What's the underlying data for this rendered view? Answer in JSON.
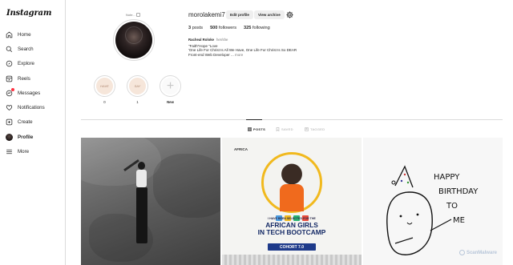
{
  "app": {
    "logo": "Instagram"
  },
  "sidebar": {
    "items": [
      {
        "label": "Home",
        "icon": "home-icon"
      },
      {
        "label": "Search",
        "icon": "search-icon"
      },
      {
        "label": "Explore",
        "icon": "explore-icon"
      },
      {
        "label": "Reels",
        "icon": "reels-icon"
      },
      {
        "label": "Messages",
        "icon": "messages-icon"
      },
      {
        "label": "Notifications",
        "icon": "heart-icon"
      },
      {
        "label": "Create",
        "icon": "create-icon"
      },
      {
        "label": "Profile",
        "icon": "profile-avatar"
      },
      {
        "label": "More",
        "icon": "menu-icon"
      }
    ]
  },
  "profile": {
    "note": "Note...",
    "username": "morolakemi7",
    "edit_profile": "Edit profile",
    "view_archive": "View archive",
    "posts_count": "3",
    "posts_label": "posts",
    "followers_count": "500",
    "followers_label": "followers",
    "following_count": "325",
    "following_label": "following",
    "full_name": "Racheal Roloke",
    "pronouns": "her/she",
    "bio_line1": "\"Faith\"Hope \"Love",
    "bio_line2": "'One Life For Christ Is All We Have, One Life For Christ Is So DEAR",
    "bio_line3": "Front-end Web Developer ...",
    "bio_more": "more"
  },
  "highlights": [
    {
      "label": "0",
      "thumb": "HAVE"
    },
    {
      "label": "1",
      "thumb": "SAY"
    },
    {
      "label": "New",
      "thumb": "+"
    }
  ],
  "tabs": [
    {
      "label": "POSTS",
      "active": true
    },
    {
      "label": "SAVED",
      "active": false
    },
    {
      "label": "TAGGED",
      "active": false
    }
  ],
  "posts": {
    "post2": {
      "logo": "AFRICA",
      "selected_text": "I HAVE BEEN SELECTED FOR THE",
      "headline1": "AFRICAN GIRLS",
      "headline2": "IN TECH BOOTCAMP",
      "cohort": "COHORT 7.0"
    },
    "post3": {
      "line1": "HAPPY",
      "line2": "BIRTHDAY",
      "line3": "TO",
      "line4": "ME"
    }
  },
  "watermark": "ScanMalware",
  "colors": {
    "accent": "#262626",
    "notification": "#ff3040",
    "cohort_blue": "#1e3a8a",
    "orange": "#f06a1d"
  }
}
